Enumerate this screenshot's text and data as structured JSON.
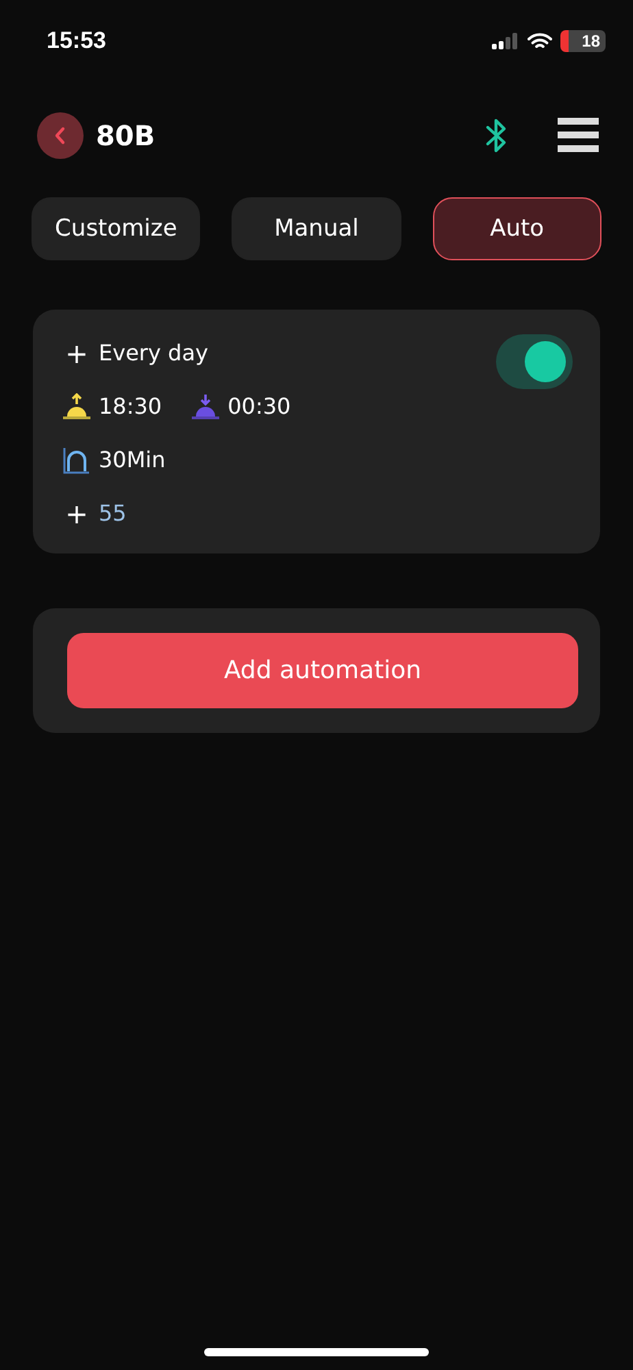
{
  "status_bar": {
    "time": "15:53",
    "battery": "18"
  },
  "header": {
    "title": "80B"
  },
  "tabs": [
    {
      "label": "Customize",
      "selected": false
    },
    {
      "label": "Manual",
      "selected": false
    },
    {
      "label": "Auto",
      "selected": true
    }
  ],
  "automation": {
    "on": true,
    "repeat_sign": "+",
    "repeat": "Every day",
    "start_time": "18:30",
    "end_time": "00:30",
    "duration": "30Min",
    "level_sign": "+",
    "value": "55"
  },
  "add_button": {
    "label": "Add automation"
  }
}
